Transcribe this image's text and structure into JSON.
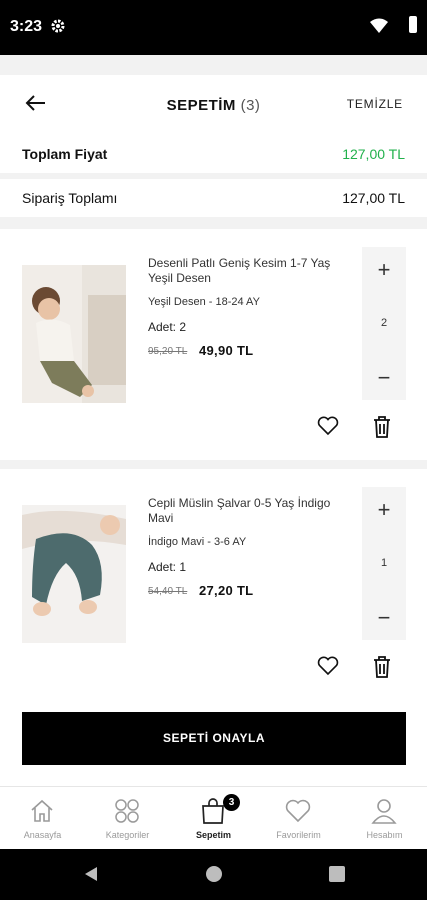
{
  "status": {
    "time": "3:23"
  },
  "header": {
    "title": "SEPETİM",
    "count": "(3)",
    "clear_label": "TEMİZLE"
  },
  "summary": {
    "total_label": "Toplam Fiyat",
    "total_value": "127,00 TL",
    "order_label": "Sipariş Toplamı",
    "order_value": "127,00 TL"
  },
  "items": [
    {
      "name": "Desenli Patlı Geniş Kesim 1-7 Yaş Yeşil Desen",
      "variant": "Yeşil Desen - 18-24 AY",
      "quantity_text": "Adet: 2",
      "old_price": "95,20 TL",
      "price": "49,90 TL",
      "quantity": "2"
    },
    {
      "name": "Cepli Müslin Şalvar 0-5 Yaş İndigo Mavi",
      "variant": "İndigo Mavi - 3-6 AY",
      "quantity_text": "Adet: 1",
      "old_price": "54,40 TL",
      "price": "27,20 TL",
      "quantity": "1"
    }
  ],
  "stepper": {
    "plus": "+",
    "minus": "−"
  },
  "confirm_label": "SEPETİ ONAYLA",
  "tabs": [
    {
      "label": "Anasayfa",
      "icon": "home-icon"
    },
    {
      "label": "Kategoriler",
      "icon": "categories-icon"
    },
    {
      "label": "Sepetim",
      "icon": "bag-icon",
      "badge": "3",
      "active": true
    },
    {
      "label": "Favorilerim",
      "icon": "heart-icon"
    },
    {
      "label": "Hesabım",
      "icon": "user-icon"
    }
  ],
  "colors": {
    "accent_green": "#22b14c",
    "button_black": "#000000"
  }
}
